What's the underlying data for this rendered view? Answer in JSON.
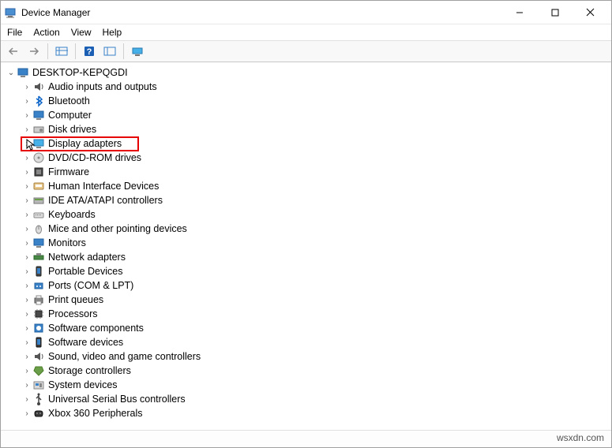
{
  "window": {
    "title": "Device Manager"
  },
  "menu": {
    "file": "File",
    "action": "Action",
    "view": "View",
    "help": "Help"
  },
  "root": {
    "name": "DESKTOP-KEPQGDI"
  },
  "categories": [
    {
      "label": "Audio inputs and outputs",
      "icon": "speaker"
    },
    {
      "label": "Bluetooth",
      "icon": "bluetooth"
    },
    {
      "label": "Computer",
      "icon": "computer"
    },
    {
      "label": "Disk drives",
      "icon": "disk"
    },
    {
      "label": "Display adapters",
      "icon": "display",
      "highlight": true
    },
    {
      "label": "DVD/CD-ROM drives",
      "icon": "dvd"
    },
    {
      "label": "Firmware",
      "icon": "firmware"
    },
    {
      "label": "Human Interface Devices",
      "icon": "hid"
    },
    {
      "label": "IDE ATA/ATAPI controllers",
      "icon": "ide"
    },
    {
      "label": "Keyboards",
      "icon": "keyboard"
    },
    {
      "label": "Mice and other pointing devices",
      "icon": "mouse"
    },
    {
      "label": "Monitors",
      "icon": "monitor"
    },
    {
      "label": "Network adapters",
      "icon": "network"
    },
    {
      "label": "Portable Devices",
      "icon": "portable"
    },
    {
      "label": "Ports (COM & LPT)",
      "icon": "ports"
    },
    {
      "label": "Print queues",
      "icon": "print"
    },
    {
      "label": "Processors",
      "icon": "cpu"
    },
    {
      "label": "Software components",
      "icon": "swcomp"
    },
    {
      "label": "Software devices",
      "icon": "swdev"
    },
    {
      "label": "Sound, video and game controllers",
      "icon": "sound"
    },
    {
      "label": "Storage controllers",
      "icon": "storage"
    },
    {
      "label": "System devices",
      "icon": "system"
    },
    {
      "label": "Universal Serial Bus controllers",
      "icon": "usb"
    },
    {
      "label": "Xbox 360 Peripherals",
      "icon": "xbox"
    }
  ],
  "watermark": "wsxdn.com"
}
